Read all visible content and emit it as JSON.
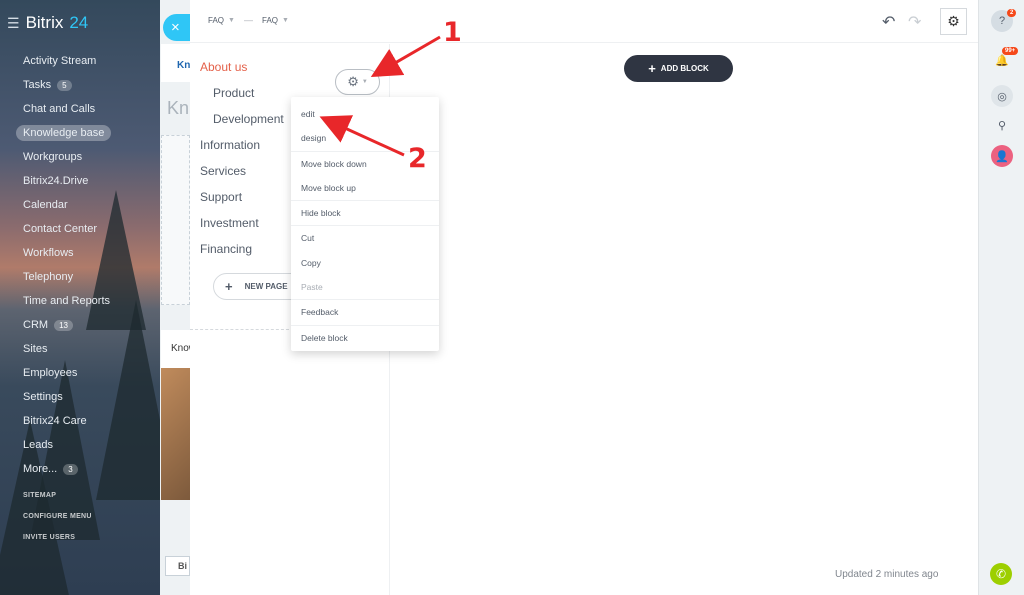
{
  "app": {
    "brand_name": "Bitrix",
    "brand_number": "24",
    "menu": [
      {
        "label": "Activity Stream"
      },
      {
        "label": "Tasks",
        "count": "5"
      },
      {
        "label": "Chat and Calls"
      },
      {
        "label": "Knowledge base",
        "active": true
      },
      {
        "label": "Workgroups"
      },
      {
        "label": "Bitrix24.Drive"
      },
      {
        "label": "Calendar"
      },
      {
        "label": "Contact Center"
      },
      {
        "label": "Workflows"
      },
      {
        "label": "Telephony"
      },
      {
        "label": "Time and Reports"
      },
      {
        "label": "CRM",
        "count": "13"
      },
      {
        "label": "Sites"
      },
      {
        "label": "Employees"
      },
      {
        "label": "Settings"
      },
      {
        "label": "Bitrix24 Care"
      },
      {
        "label": "Leads"
      },
      {
        "label": "More...",
        "count": "3"
      }
    ],
    "bottom_links": [
      "SITEMAP",
      "CONFIGURE MENU",
      "INVITE USERS"
    ],
    "bg_tab": "Kn",
    "bg_title": "Kn",
    "bg_card_title": "Know",
    "bg_button": "Bi",
    "close_label": "×"
  },
  "editor": {
    "breadcrumb": [
      "FAQ",
      "FAQ"
    ],
    "breadcrumb_sep": "—",
    "nav": [
      "About us",
      "Product",
      "Development",
      "Information",
      "Services",
      "Support",
      "Investment",
      "Financing"
    ],
    "new_page_label": "NEW PAGE",
    "add_block_label": "ADD BLOCK",
    "updated_text": "Updated 2 minutes ago",
    "block_menu": [
      "edit",
      "design",
      "Move block down",
      "Move block up",
      "Hide block",
      "Cut",
      "Copy",
      "Paste",
      "Feedback",
      "Delete block"
    ]
  },
  "right_panel": {
    "help_badge": "2",
    "notifications_badge": "99+"
  },
  "annotations": [
    "1",
    "2"
  ],
  "colors": {
    "accent_red": "#e4614a",
    "annotation_red": "#e8272a",
    "bitrix_blue": "#2fc6f6",
    "dark_button": "#2f3542",
    "phone_green": "#9dcf00"
  }
}
